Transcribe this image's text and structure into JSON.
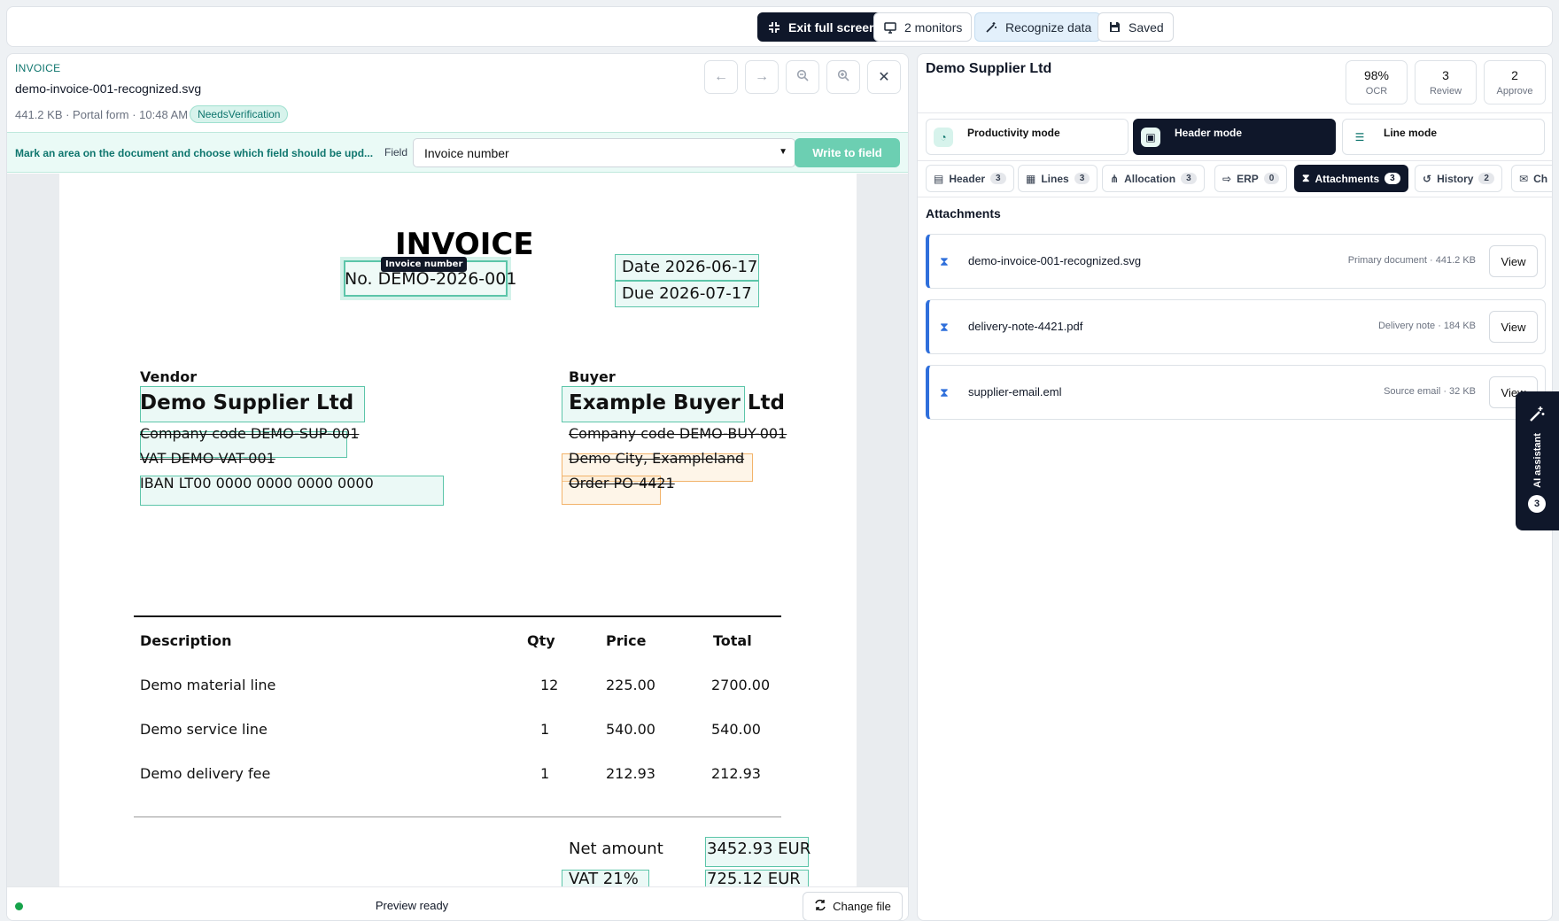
{
  "toolbar": {
    "exit_fullscreen": "Exit full screen",
    "monitors": "2 monitors",
    "recognize": "Recognize data",
    "saved": "Saved"
  },
  "document": {
    "kind": "INVOICE",
    "filename": "demo-invoice-001-recognized.svg",
    "meta": "441.2 KB · Portal form · 10:48 AM",
    "status_badge": "NeedsVerification"
  },
  "markbar": {
    "instruction": "Mark an area on the document and choose which field should be upd...",
    "field_label": "Field",
    "field_value": "Invoice number",
    "write_button": "Write to field"
  },
  "invoice_page": {
    "title": "INVOICE",
    "field_tag": "Invoice number",
    "number": "No. DEMO-2026-001",
    "date": "Date 2026-06-17",
    "due": "Due 2026-07-17",
    "vendor": {
      "heading": "Vendor",
      "name": "Demo Supplier Ltd",
      "company_code": "Company code DEMO-SUP-001",
      "vat": "VAT DEMO-VAT-001",
      "iban": "IBAN LT00 0000 0000 0000 0000"
    },
    "buyer": {
      "heading": "Buyer",
      "name": "Example Buyer Ltd",
      "company_code": "Company code DEMO-BUY-001",
      "city": "Demo City, Exampleland",
      "order": "Order PO-4421"
    },
    "table": {
      "headers": [
        "Description",
        "Qty",
        "Price",
        "Total"
      ],
      "rows": [
        [
          "Demo material line",
          "12",
          "225.00",
          "2700.00"
        ],
        [
          "Demo service line",
          "1",
          "540.00",
          "540.00"
        ],
        [
          "Demo delivery fee",
          "1",
          "212.93",
          "212.93"
        ]
      ]
    },
    "net_label": "Net amount",
    "net_value": "3452.93 EUR",
    "vat_label": "VAT 21%",
    "vat_value": "725.12 EUR"
  },
  "footer": {
    "status": "Preview ready",
    "change_file": "Change file"
  },
  "right_panel": {
    "supplier": "Demo Supplier Ltd",
    "stats": [
      {
        "value": "98%",
        "label": "OCR"
      },
      {
        "value": "3",
        "label": "Review"
      },
      {
        "value": "2",
        "label": "Approve"
      }
    ],
    "modes": [
      {
        "label": "Productivity mode"
      },
      {
        "label": "Header mode"
      },
      {
        "label": "Line mode"
      }
    ],
    "tabs": [
      {
        "label": "Header",
        "count": "3"
      },
      {
        "label": "Lines",
        "count": "3"
      },
      {
        "label": "Allocation",
        "count": "3"
      },
      {
        "label": "ERP",
        "count": "0"
      },
      {
        "label": "Attachments",
        "count": "3"
      },
      {
        "label": "History",
        "count": "2"
      },
      {
        "label": "Ch",
        "count": ""
      }
    ],
    "attachments_title": "Attachments",
    "attachments": [
      {
        "name": "demo-invoice-001-recognized.svg",
        "info": "Primary document · 441.2 KB",
        "action": "View"
      },
      {
        "name": "delivery-note-4421.pdf",
        "info": "Delivery note · 184 KB",
        "action": "View"
      },
      {
        "name": "supplier-email.eml",
        "info": "Source email · 32 KB",
        "action": "View"
      }
    ]
  },
  "ai_assistant": {
    "label": "AI assistant",
    "count": "3"
  },
  "colors": {
    "accent_teal": "#5cc5a9",
    "dark": "#0f172a",
    "link_blue": "#2f6fdb",
    "warning_orange": "#f2b36a"
  }
}
